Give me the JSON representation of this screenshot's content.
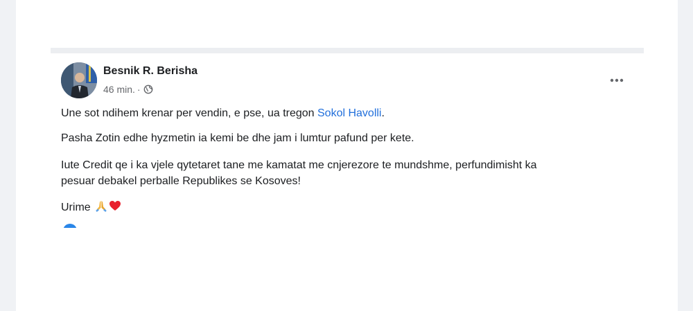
{
  "post": {
    "author": "Besnik R. Berisha",
    "time": "46 min.",
    "separator": "·",
    "privacy_icon": "globe-icon",
    "more_icon": "more-options-icon",
    "paragraphs": {
      "p1_text": "Une sot ndihem krenar per vendin, e pse, ua tregon ",
      "p1_link": "Sokol Havolli",
      "p1_end": ".",
      "p2": "Pasha Zotin edhe hyzmetin ia kemi be dhe jam i lumtur pafund per kete.",
      "p3_line1": "Iute Credit qe i ka vjele qytetaret tane me kamatat me cnjerezore te mundshme, perfundimisht ka",
      "p3_line2": "pesuar debakel perballe Republikes se Kosoves!",
      "p4": "Urime"
    },
    "emojis": [
      "praying-hands-icon",
      "red-heart-icon"
    ]
  },
  "colors": {
    "link": "#216fdb",
    "text": "#1c1e21",
    "secondary": "#65676b",
    "background": "#f0f2f5"
  }
}
